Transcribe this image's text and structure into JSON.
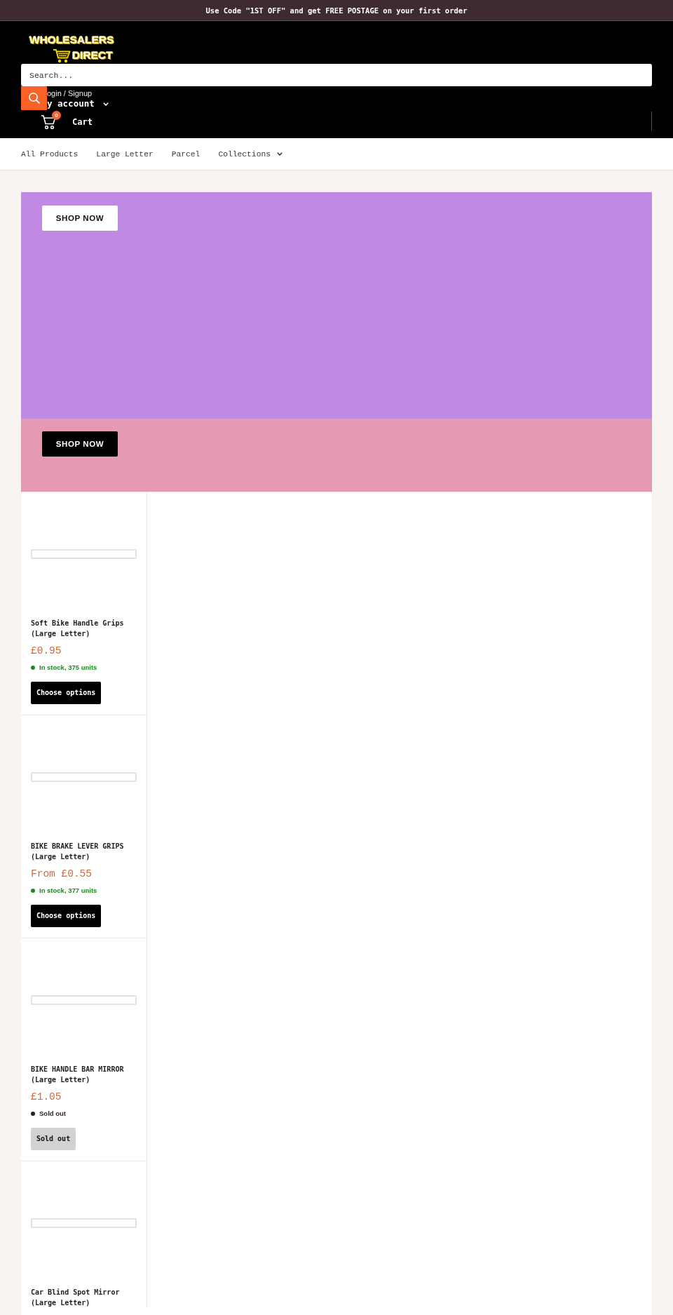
{
  "announcement_bar": {
    "text": "Use Code \"1ST OFF\" and get FREE POSTAGE on your first order"
  },
  "header": {
    "logo": {
      "lines": [
        "WHOLESALERS",
        "DIRECT"
      ]
    },
    "search": {
      "placeholder": "Search..."
    },
    "login_link": "ogin / Signup",
    "account_menu": {
      "label": "y account"
    },
    "cart": {
      "label": "Cart",
      "count": "0"
    }
  },
  "nav": {
    "items": [
      {
        "label": "All Products",
        "has_dropdown": false
      },
      {
        "label": "Large Letter",
        "has_dropdown": false
      },
      {
        "label": "Parcel",
        "has_dropdown": false
      },
      {
        "label": "Collections",
        "has_dropdown": true
      }
    ]
  },
  "banners": [
    {
      "kind": "primary",
      "color": "#c089e2",
      "button_label": "SHOP NOW"
    },
    {
      "kind": "secondary",
      "color": "#e59ab4",
      "button_label": "SHOP NOW"
    }
  ],
  "products": [
    {
      "title": "Soft Bike Handle Grips (Large Letter)",
      "price": "£0.95",
      "stock": {
        "text": "In stock, 375 units",
        "color": "#1f8a24"
      },
      "button": {
        "label": "Choose options",
        "disabled": false
      }
    },
    {
      "title": "BIKE BRAKE LEVER GRIPS (Large Letter)",
      "price": "From £0.55",
      "stock": {
        "text": "In stock, 377 units",
        "color": "#1f8a24"
      },
      "button": {
        "label": "Choose options",
        "disabled": false
      }
    },
    {
      "title": "BIKE HANDLE BAR MIRROR (Large Letter)",
      "price": "£1.05",
      "stock": {
        "text": "Sold out",
        "color": "#2e1f26"
      },
      "button": {
        "label": "Sold out",
        "disabled": true
      }
    },
    {
      "title": "Car Blind Spot Mirror (Large Letter)"
    }
  ]
}
